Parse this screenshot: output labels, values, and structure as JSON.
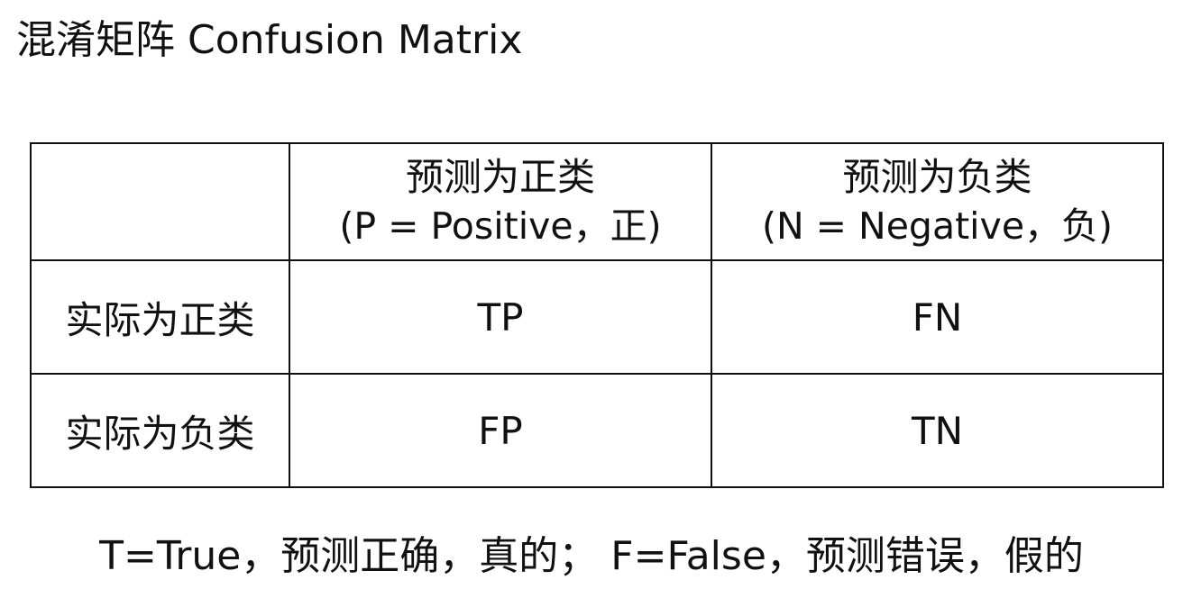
{
  "title": "混淆矩阵 Confusion Matrix",
  "table": {
    "corner": "",
    "columns": [
      {
        "line1": "预测为正类",
        "line2": "(P = Positive，正)"
      },
      {
        "line1": "预测为负类",
        "line2": "(N = Negative，负)"
      }
    ],
    "rows": [
      {
        "label": "实际为正类",
        "cells": [
          "TP",
          "FN"
        ]
      },
      {
        "label": "实际为负类",
        "cells": [
          "FP",
          "TN"
        ]
      }
    ]
  },
  "footer": "T=True，预测正确，真的； F=False，预测错误，假的"
}
